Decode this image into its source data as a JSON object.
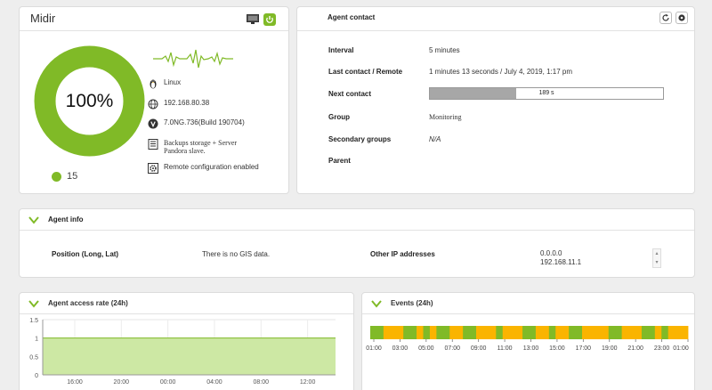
{
  "agent": {
    "name": "Midir",
    "percent": "100%",
    "count": "15",
    "os": "Linux",
    "ip": "192.168.80.38",
    "version": "7.0NG.736(Build 190704)",
    "description_line1": "Backups storage + Server",
    "description_line2": "Pandora slave.",
    "remote_config": "Remote configuration enabled",
    "icons": [
      "monitor-icon",
      "power-icon",
      "linux-icon",
      "network-icon",
      "version-icon",
      "list-icon",
      "gear-icon"
    ],
    "colors": {
      "donut": "#80ba27",
      "heartbeat": "#80ba27"
    }
  },
  "contact": {
    "title": "Agent contact",
    "rows": [
      {
        "label": "Interval",
        "value": "5 minutes"
      },
      {
        "label": "Last contact / Remote",
        "value": "1 minutes 13 seconds / July 4, 2019, 1:17 pm"
      },
      {
        "label": "Next contact",
        "value": ""
      },
      {
        "label": "Group",
        "value": "Monitoring"
      },
      {
        "label": "Secondary groups",
        "value": "N/A"
      },
      {
        "label": "Parent",
        "value": ""
      }
    ],
    "next_contact_text": "189 s",
    "next_contact_progress": 0.37
  },
  "info": {
    "title": "Agent info",
    "position_label": "Position (Long, Lat)",
    "position_value": "There is no GIS data.",
    "other_ip_label": "Other IP addresses",
    "other_ip_1": "0.0.0.0",
    "other_ip_2": "192.168.11.1"
  },
  "access": {
    "title": "Agent access rate (24h)"
  },
  "events": {
    "title": "Events (24h)"
  },
  "chart_data": [
    {
      "type": "area",
      "title": "Agent access rate (24h)",
      "x": [
        "16:00",
        "20:00",
        "00:00",
        "04:00",
        "08:00",
        "12:00"
      ],
      "y_ticks": [
        "0",
        "0.5",
        "1",
        "1.5"
      ],
      "ylim": [
        0,
        1.5
      ],
      "series": [
        {
          "values": [
            1,
            1,
            1,
            1,
            1,
            1
          ]
        }
      ],
      "grid": true,
      "color": "#cde8a4",
      "line_color": "#80ba27"
    },
    {
      "type": "bar",
      "title": "Events (24h)",
      "tick_labels": [
        "01:00",
        "03:00",
        "05:00",
        "07:00",
        "09:00",
        "11:00",
        "13:00",
        "15:00",
        "17:00",
        "19:00",
        "21:00",
        "23:00",
        "01:00"
      ],
      "segments": [
        "g",
        "g",
        "o",
        "o",
        "o",
        "g",
        "g",
        "o",
        "g",
        "o",
        "g",
        "g",
        "o",
        "o",
        "g",
        "g",
        "o",
        "o",
        "o",
        "g",
        "o",
        "o",
        "o",
        "g",
        "g",
        "o",
        "o",
        "g",
        "o",
        "o",
        "g",
        "g",
        "o",
        "o",
        "o",
        "o",
        "g",
        "g",
        "o",
        "o",
        "o",
        "g",
        "g",
        "o",
        "g",
        "o",
        "o",
        "o"
      ],
      "colors": {
        "g": "#80ba27",
        "o": "#fab400"
      }
    }
  ]
}
